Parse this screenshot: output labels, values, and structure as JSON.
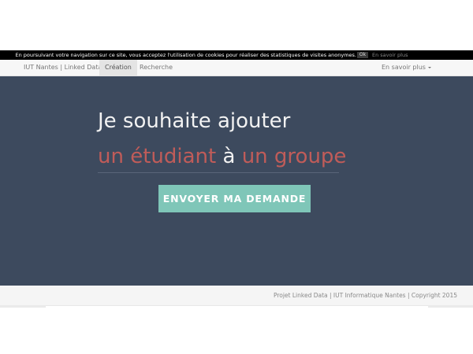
{
  "cookie_bar": {
    "message": "En poursuivant votre navigation sur ce site, vous acceptez l'utilisation de cookies pour réaliser des statistiques de visites anonymes.",
    "ok_label": "Ok",
    "more_label": "En savoir plus"
  },
  "navbar": {
    "brand": "IUT Nantes | Linked Data",
    "items": [
      {
        "label": "Création",
        "active": true
      },
      {
        "label": "Recherche",
        "active": false
      }
    ],
    "dropdown_label": "En savoir plus"
  },
  "hero": {
    "line1": "Je souhaite ajouter",
    "line2_part1": "un étudiant",
    "line2_part2": " à ",
    "line2_part3": "un groupe",
    "button_label": "ENVOYER MA DEMANDE",
    "colors": {
      "background": "#3d4a5e",
      "accent_text": "#c05c59",
      "button": "#7fc6b8"
    }
  },
  "footer": {
    "text": "Projet Linked Data | IUT Informatique Nantes | Copyright 2015"
  }
}
